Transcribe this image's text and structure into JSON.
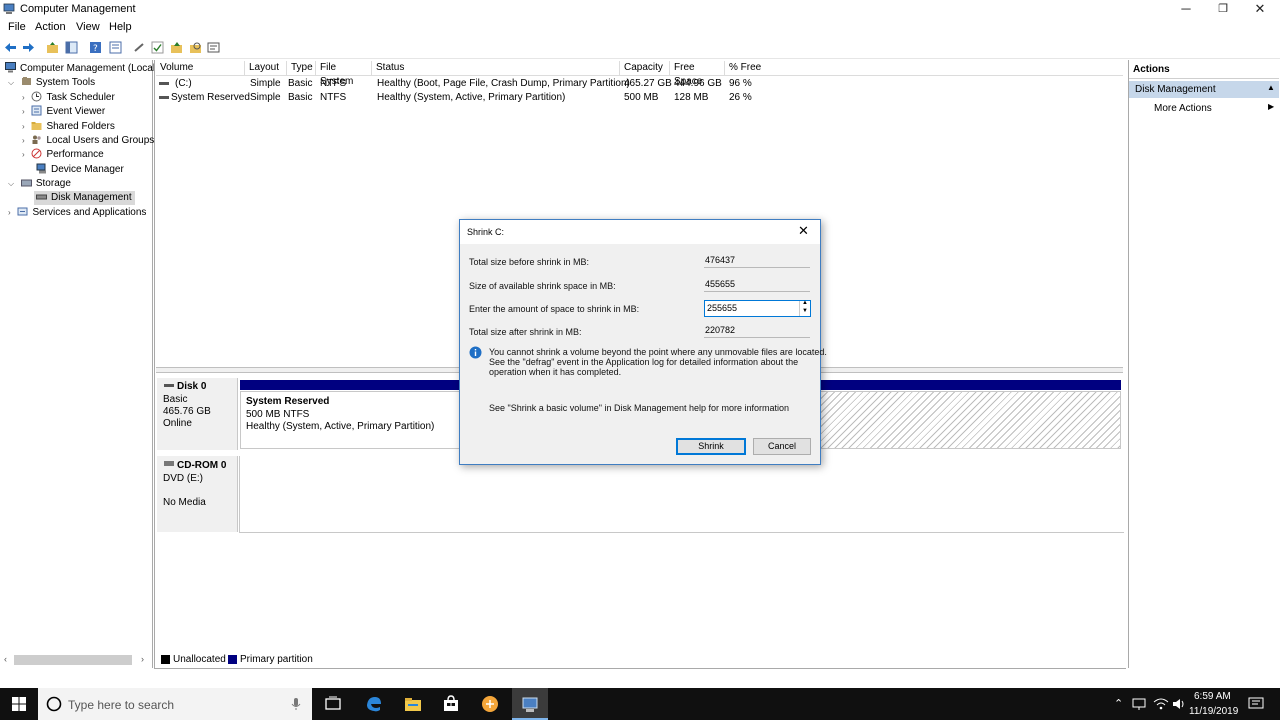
{
  "window": {
    "title": "Computer Management",
    "minimize": "─",
    "restore": "❐",
    "close": "✕"
  },
  "menu": [
    "File",
    "Action",
    "View",
    "Help"
  ],
  "tree": {
    "root": "Computer Management (Local",
    "system_tools": "System Tools",
    "task_scheduler": "Task Scheduler",
    "event_viewer": "Event Viewer",
    "shared_folders": "Shared Folders",
    "local_users": "Local Users and Groups",
    "performance": "Performance",
    "device_manager": "Device Manager",
    "storage": "Storage",
    "disk_management": "Disk Management",
    "services": "Services and Applications"
  },
  "volume_list": {
    "headers": [
      "Volume",
      "Layout",
      "Type",
      "File System",
      "Status",
      "Capacity",
      "Free Space",
      "% Free"
    ],
    "rows": [
      [
        "(C:)",
        "Simple",
        "Basic",
        "NTFS",
        "Healthy (Boot, Page File, Crash Dump, Primary Partition)",
        "465.27 GB",
        "444.96 GB",
        "96 %"
      ],
      [
        "System Reserved",
        "Simple",
        "Basic",
        "NTFS",
        "Healthy (System, Active, Primary Partition)",
        "500 MB",
        "128 MB",
        "26 %"
      ]
    ]
  },
  "disks": {
    "disk0": {
      "name": "Disk 0",
      "type": "Basic",
      "size": "465.76 GB",
      "status": "Online"
    },
    "partition": {
      "name": "System Reserved",
      "size": "500 MB NTFS",
      "status": "Healthy (System, Active, Primary Partition)"
    },
    "cdrom": {
      "name": "CD-ROM 0",
      "type": "DVD (E:)",
      "status": "No Media"
    }
  },
  "legend": {
    "unallocated": "Unallocated",
    "primary": "Primary partition",
    "unallocated_color": "#000000",
    "primary_color": "#000080"
  },
  "actions": {
    "title": "Actions",
    "section": "Disk Management",
    "more": "More Actions"
  },
  "dialog": {
    "title": "Shrink C:",
    "total_before_label": "Total size before shrink in MB:",
    "total_before": "476437",
    "available_label": "Size of available shrink space in MB:",
    "available": "455655",
    "amount_label": "Enter the amount of space to shrink in MB:",
    "amount": "255655",
    "total_after_label": "Total size after shrink in MB:",
    "total_after": "220782",
    "info_line1": "You cannot shrink a volume beyond the point where any unmovable files are located.",
    "info_line2": "See the \"defrag\" event in the Application log for detailed information about the",
    "info_line3": "operation when it has completed.",
    "help_text": "See \"Shrink a basic volume\" in Disk Management help for more information",
    "shrink_button": "Shrink",
    "cancel_button": "Cancel"
  },
  "taskbar": {
    "search_placeholder": "Type here to search",
    "time": "6:59 AM",
    "date": "11/19/2019"
  }
}
